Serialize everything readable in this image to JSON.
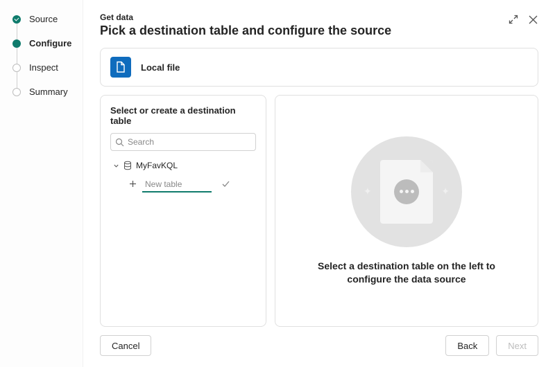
{
  "steps": [
    {
      "label": "Source",
      "state": "done"
    },
    {
      "label": "Configure",
      "state": "active"
    },
    {
      "label": "Inspect",
      "state": "pending"
    },
    {
      "label": "Summary",
      "state": "pending"
    }
  ],
  "header": {
    "subtitle": "Get data",
    "title": "Pick a destination table and configure the source"
  },
  "source": {
    "icon": "file-icon",
    "label": "Local file"
  },
  "left_panel": {
    "title": "Select or create a destination table",
    "search_placeholder": "Search",
    "tree": {
      "database_name": "MyFavKQL",
      "new_table_placeholder": "New table",
      "new_table_value": ""
    }
  },
  "right_panel": {
    "message": "Select a destination table on the left to configure the data source"
  },
  "footer": {
    "cancel": "Cancel",
    "back": "Back",
    "next": "Next",
    "next_disabled": true
  }
}
